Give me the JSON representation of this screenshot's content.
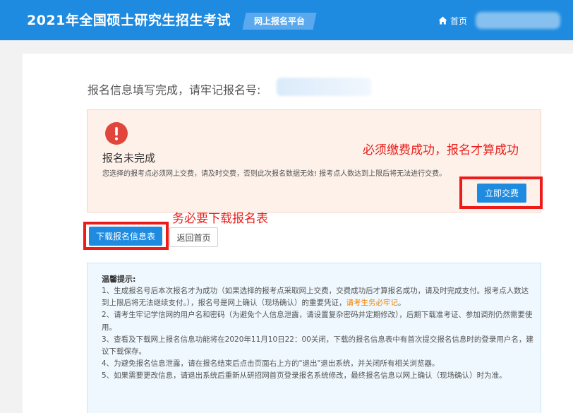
{
  "header": {
    "title": "2021年全国硕士研究生招生考试",
    "badge": "网上报名平台",
    "home_label": "首页"
  },
  "main": {
    "headline": "报名信息填写完成，请牢记报名号:"
  },
  "alert": {
    "title": "报名未完成",
    "description": "您选择的报考点必须网上交费，请及时交费，否则此次报名数据无效! 报考点人数达到上限后将无法进行交费。",
    "pay_button": "立即交费"
  },
  "annotations": {
    "must_pay": "必须缴费成功，报名才算成功",
    "must_download": "务必要下载报名表"
  },
  "actions": {
    "download_button": "下载报名信息表",
    "back_button": "返回首页"
  },
  "tips": {
    "title": "温馨提示:",
    "item1_a": "1、生成报名号后本次报名才为成功（如果选择的报考点采取网上交费，交费成功后才算报名成功，请及时完成支付。报考点人数达到上限后将无法继续支付。），报名号是网上确认（现场确认）的重要凭证，",
    "item1_hl": "请考生务必牢记",
    "item1_end": "。",
    "item2": "2、请考生牢记学信网的用户名和密码（为避免个人信息泄露，请设置复杂密码并定期修改），后期下载准考证、参加调剂仍然需要使用。",
    "item3": "3、查看及下载网上报名信息功能将在2020年11月10日22：00关闭，下载的报名信息表中有首次提交报名信息时的登录用户名，建议下载保存。",
    "item4": "4、为避免报名信息泄露，请在报名结束后点击页面右上方的\"退出\"退出系统，并关闭所有相关浏览器。",
    "item5": "5、如果需要更改信息，请退出系统后重新从研招网首页登录报名系统修改，最终报名信息以网上确认（现场确认）时为准。"
  },
  "colors": {
    "header_bg": "#1e8be0",
    "primary_button": "#1e8be0",
    "alert_bg": "#fdf1ea",
    "alert_icon": "#e0463c",
    "annotation_red": "#e8201c",
    "tips_bg": "#eef8fe",
    "highlight": "#f08300"
  },
  "icons": {
    "home": "home-icon",
    "alert": "exclamation-circle-icon"
  }
}
